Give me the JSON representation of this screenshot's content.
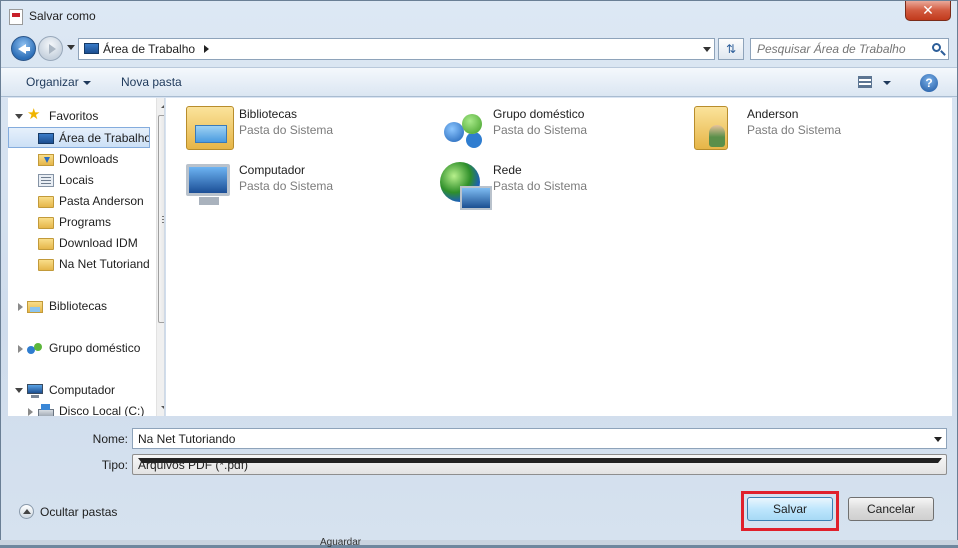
{
  "window": {
    "title": "Salvar como",
    "close_label": "✕"
  },
  "address": {
    "path_label": "Área de Trabalho"
  },
  "search": {
    "placeholder": "Pesquisar Área de Trabalho"
  },
  "toolbar": {
    "organize_label": "Organizar",
    "new_folder_label": "Nova pasta",
    "help_label": "?"
  },
  "nav": {
    "favorites_label": "Favoritos",
    "items": [
      {
        "label": "Área de Trabalho"
      },
      {
        "label": "Downloads"
      },
      {
        "label": "Locais"
      },
      {
        "label": "Pasta Anderson"
      },
      {
        "label": "Programs"
      },
      {
        "label": "Download IDM"
      },
      {
        "label": "Na Net Tutoriando"
      }
    ],
    "libraries_label": "Bibliotecas",
    "homegroup_label": "Grupo doméstico",
    "computer_label": "Computador",
    "disk_label": "Disco Local (C:)"
  },
  "content": {
    "items": [
      {
        "name": "Bibliotecas",
        "type": "Pasta do Sistema",
        "icon": "libraries-icon"
      },
      {
        "name": "Grupo doméstico",
        "type": "Pasta do Sistema",
        "icon": "homegroup-icon"
      },
      {
        "name": "Anderson",
        "type": "Pasta do Sistema",
        "icon": "user-folder-icon"
      },
      {
        "name": "Computador",
        "type": "Pasta do Sistema",
        "icon": "computer-icon"
      },
      {
        "name": "Rede",
        "type": "Pasta do Sistema",
        "icon": "network-icon"
      }
    ]
  },
  "form": {
    "name_label": "Nome:",
    "name_value": "Na Net Tutoriando",
    "type_label": "Tipo:",
    "type_value": "Arquivos PDF (*.pdf)"
  },
  "footer": {
    "hide_folders_label": "Ocultar pastas",
    "save_label": "Salvar",
    "cancel_label": "Cancelar"
  },
  "background": {
    "taskbar_hint": "Aguardar"
  },
  "colors": {
    "highlight": "#e0202b",
    "close": "#c13a1c"
  }
}
